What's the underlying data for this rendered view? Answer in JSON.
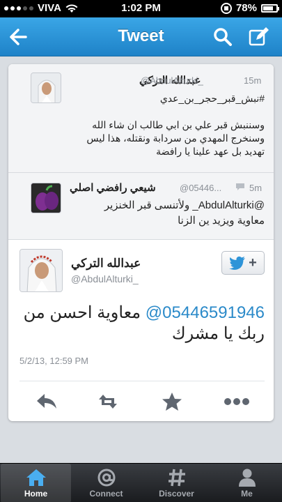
{
  "status_bar": {
    "carrier": "VIVA",
    "time": "1:02 PM",
    "battery": "78%",
    "battery_level": 0.78
  },
  "nav": {
    "title": "Tweet",
    "icons": [
      "back-arrow-icon",
      "search-icon",
      "compose-icon"
    ]
  },
  "tweet1": {
    "name": "عبدالله التركي",
    "handle": "@AbdulAlturki_",
    "time": "15m",
    "text_lines": [
      "#نبش_قبر_حجر_بن_عدي",
      "",
      "وسننبش قبر علي بن ابي طالب ان شاء الله",
      "وسنخرج المهدي من سردابة ونقتله، هذا ليس",
      "تهديد بل عهد علينا يا رافضة"
    ]
  },
  "tweet2": {
    "name": "شيعي رافضي اصلي",
    "handle": "@05446...",
    "time": "5m",
    "text_lines": [
      "@AbdulAlturki_ ولأتنسى قبر الخنزير",
      "معاوية ويزيد ين الزنا"
    ]
  },
  "main_tweet": {
    "name": "عبدالله التركي",
    "handle": "@AbdulAlturki_",
    "mention": "@0544659194‎6",
    "mention_display": "0544659194‎6@",
    "text": "معاوية احسن من ربك يا مشرك",
    "timestamp": "5/2/13, 12:59 PM",
    "follow_label": "+"
  },
  "actions": [
    "reply-icon",
    "retweet-icon",
    "favorite-star-icon",
    "more-icon"
  ],
  "tabs": [
    {
      "label": "Home",
      "icon": "home-icon",
      "active": true
    },
    {
      "label": "Connect",
      "icon": "at-icon",
      "active": false
    },
    {
      "label": "Discover",
      "icon": "hash-icon",
      "active": false
    },
    {
      "label": "Me",
      "icon": "person-icon",
      "active": false
    }
  ],
  "colors": {
    "nav_blue": "#2e94d8",
    "link_blue": "#2b8ac9",
    "tabbar": "#1f2124"
  }
}
